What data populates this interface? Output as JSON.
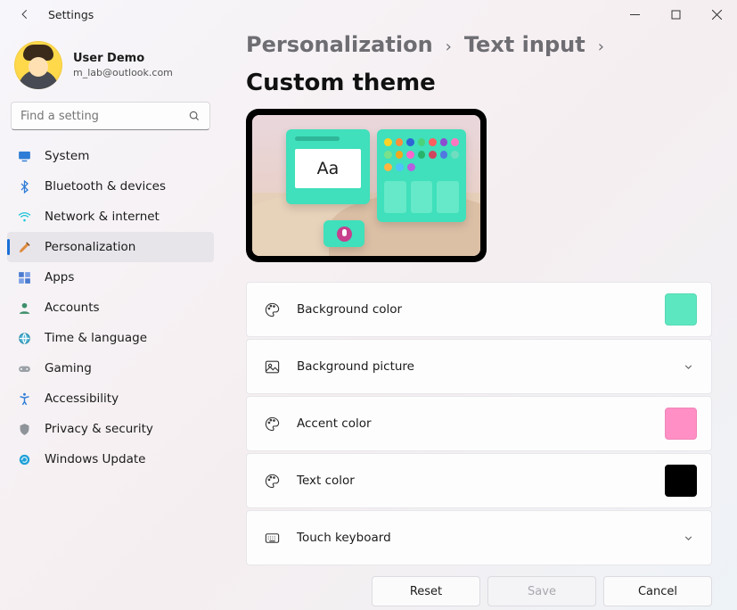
{
  "window": {
    "title": "Settings"
  },
  "user": {
    "name": "User Demo",
    "email": "m_lab@outlook.com"
  },
  "search": {
    "placeholder": "Find a setting"
  },
  "nav": {
    "items": [
      {
        "id": "system",
        "label": "System",
        "icon": "monitor"
      },
      {
        "id": "bluetooth",
        "label": "Bluetooth & devices",
        "icon": "bluetooth"
      },
      {
        "id": "network",
        "label": "Network & internet",
        "icon": "wifi"
      },
      {
        "id": "personalization",
        "label": "Personalization",
        "icon": "brush",
        "selected": true
      },
      {
        "id": "apps",
        "label": "Apps",
        "icon": "grid"
      },
      {
        "id": "accounts",
        "label": "Accounts",
        "icon": "person"
      },
      {
        "id": "time",
        "label": "Time & language",
        "icon": "globe"
      },
      {
        "id": "gaming",
        "label": "Gaming",
        "icon": "gamepad"
      },
      {
        "id": "accessibility",
        "label": "Accessibility",
        "icon": "accessibility"
      },
      {
        "id": "privacy",
        "label": "Privacy & security",
        "icon": "shield"
      },
      {
        "id": "update",
        "label": "Windows Update",
        "icon": "update"
      }
    ]
  },
  "breadcrumb": {
    "level1": "Personalization",
    "level2": "Text input",
    "current": "Custom theme"
  },
  "preview": {
    "sample_text": "Aa"
  },
  "settings": [
    {
      "id": "bg_color",
      "label": "Background color",
      "icon": "palette",
      "kind": "swatch",
      "value": "#5de7c0"
    },
    {
      "id": "bg_picture",
      "label": "Background picture",
      "icon": "picture",
      "kind": "expand"
    },
    {
      "id": "accent",
      "label": "Accent color",
      "icon": "palette",
      "kind": "swatch",
      "value": "#ff8fc4"
    },
    {
      "id": "text_color",
      "label": "Text color",
      "icon": "palette",
      "kind": "swatch",
      "value": "#000000"
    },
    {
      "id": "touch_kbd",
      "label": "Touch keyboard",
      "icon": "keyboard",
      "kind": "expand"
    }
  ],
  "buttons": {
    "reset": "Reset",
    "save": "Save",
    "cancel": "Cancel"
  }
}
